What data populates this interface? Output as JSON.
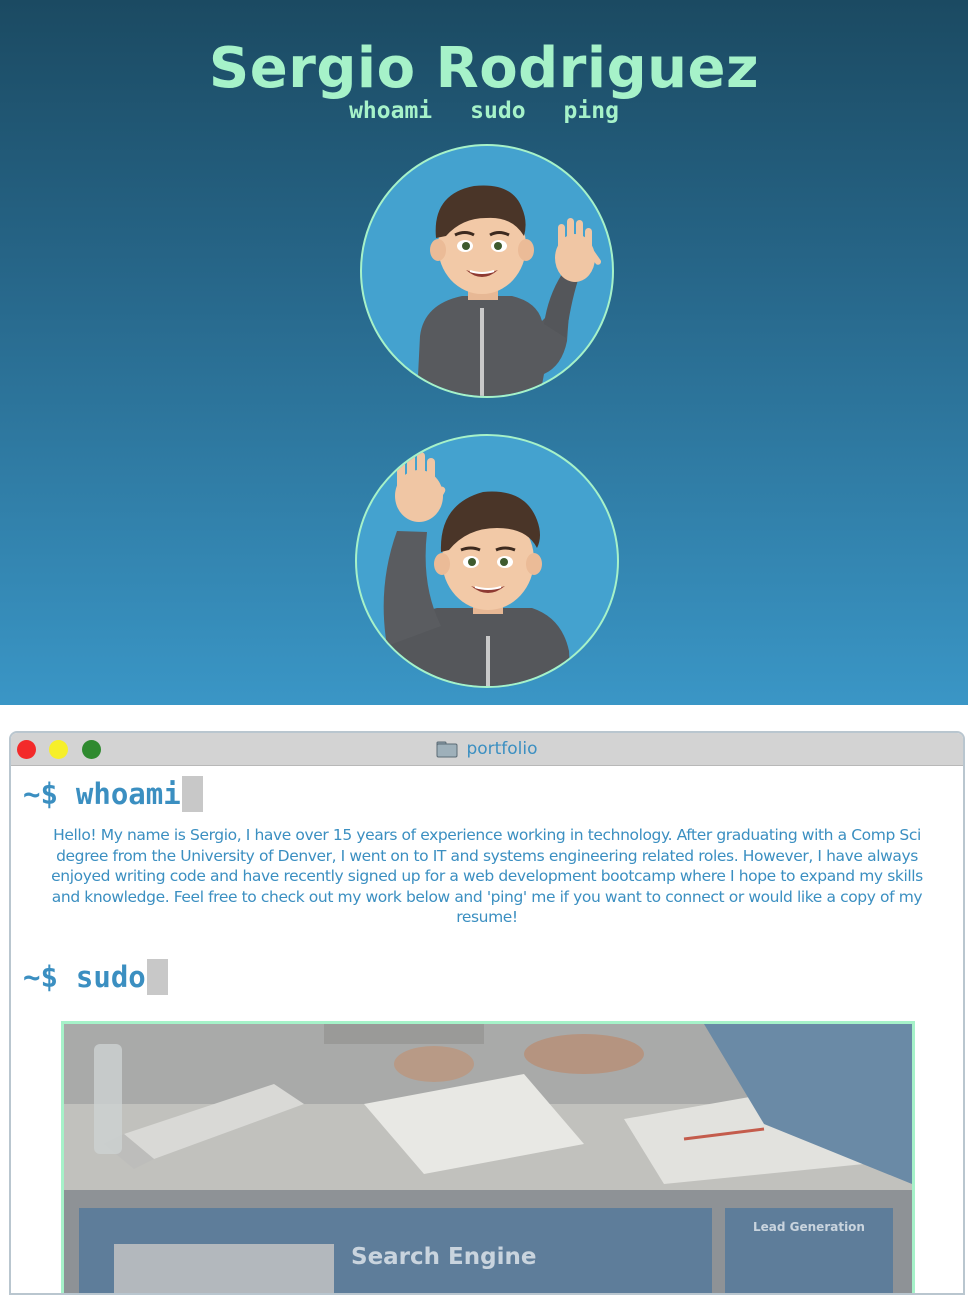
{
  "header": {
    "name": "Sergio Rodriguez",
    "nav": [
      {
        "label": "whoami"
      },
      {
        "label": "sudo"
      },
      {
        "label": "ping"
      }
    ]
  },
  "avatars": [
    {
      "icon": "waving-memoji-avatar"
    },
    {
      "icon": "hand-raised-memoji-avatar"
    }
  ],
  "terminal": {
    "title": "portfolio",
    "title_icon": "folder-icon",
    "prompt_symbol": "~$",
    "sections": [
      {
        "command": "whoami",
        "body": "Hello! My name is Sergio, I have over 15 years of experience working in technology. After graduating with a Comp Sci degree from the University of Denver, I went on to IT and systems engineering related roles. However, I have always enjoyed writing code and have recently signed up for a web development bootcamp where I hope to expand my skills and knowledge. Feel free to check out my work below and 'ping' me if you want to connect or would like a copy of my resume!"
      },
      {
        "command": "sudo"
      }
    ],
    "projects": [
      {
        "title": "Search Engine",
        "side_title": "Lead Generation"
      }
    ]
  },
  "colors": {
    "accent": "#a6f2c9",
    "terminal_text": "#3b8fc1",
    "gradient_top": "#1b4a62",
    "gradient_bottom": "#3a96c6"
  }
}
